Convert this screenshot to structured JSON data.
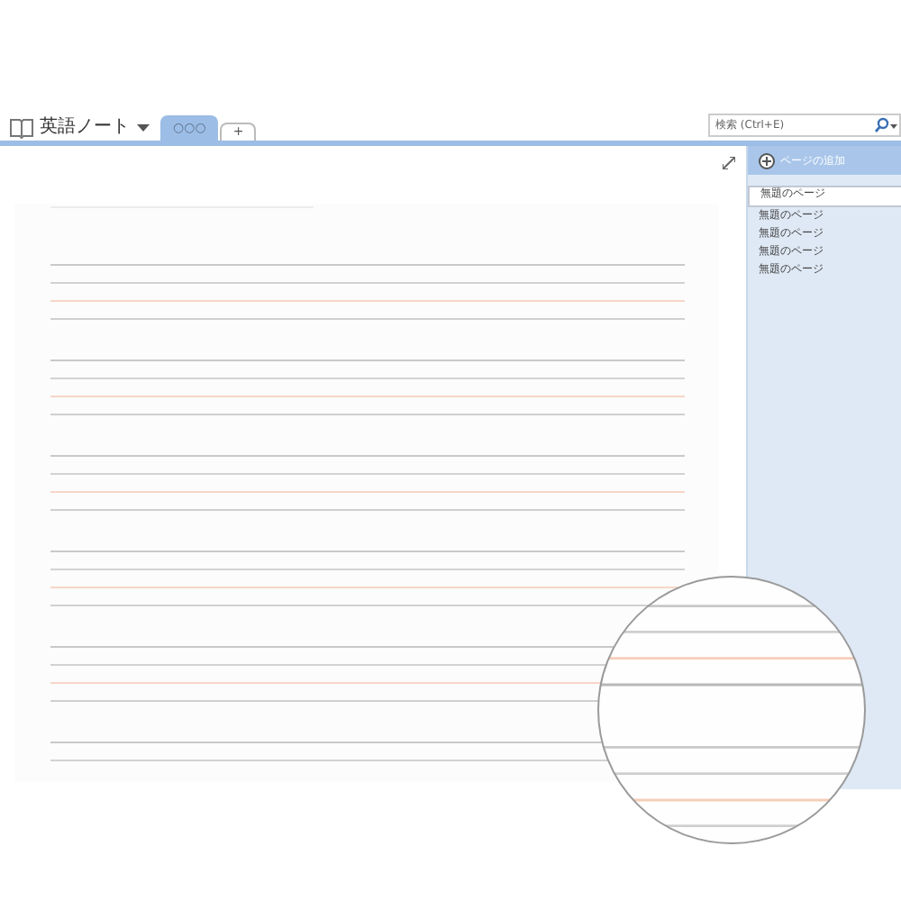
{
  "notebook": {
    "title": "英語ノート"
  },
  "tabs": [
    {
      "label": "○○○",
      "selected": true
    },
    {
      "label": "+",
      "selected": false
    }
  ],
  "search": {
    "placeholder": "検索 (Ctrl+E)"
  },
  "pages_panel": {
    "add_label": "ページの追加",
    "pages": [
      {
        "title": "無題のページ",
        "selected": true
      },
      {
        "title": "無題のページ",
        "selected": false
      },
      {
        "title": "無題のページ",
        "selected": false
      },
      {
        "title": "無題のページ",
        "selected": false
      },
      {
        "title": "無題のページ",
        "selected": false
      }
    ]
  }
}
